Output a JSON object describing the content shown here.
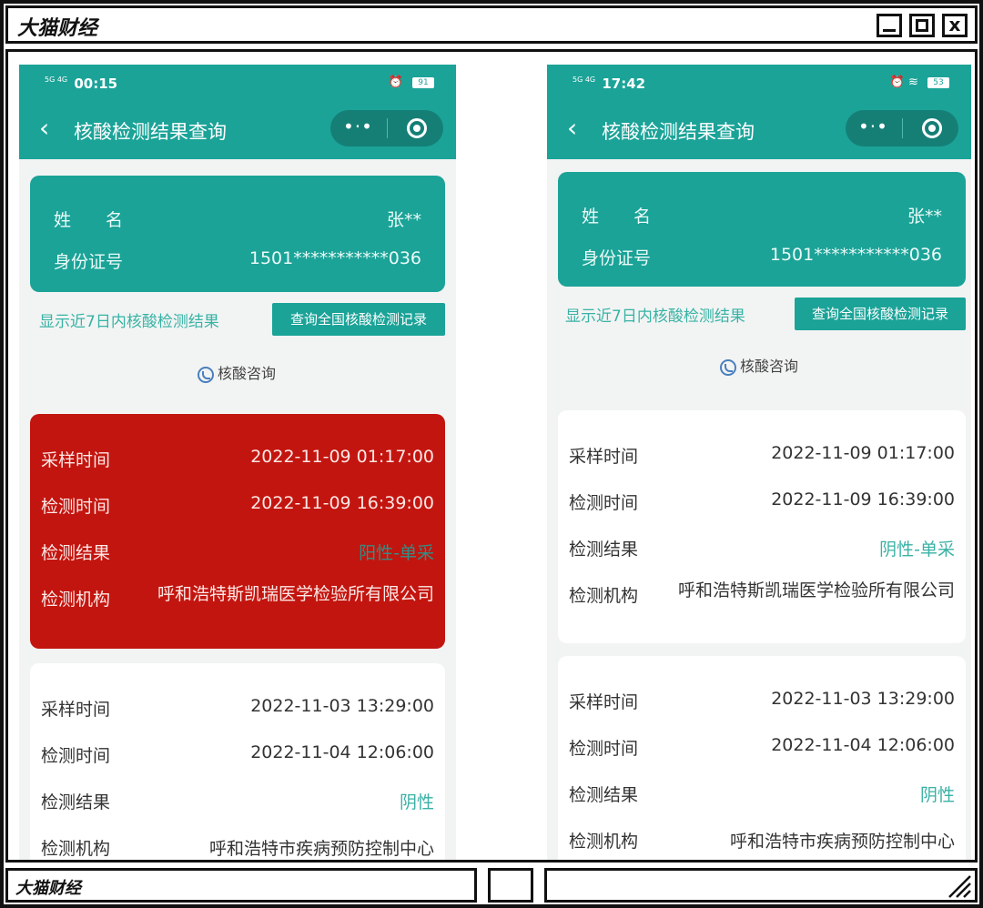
{
  "window": {
    "brand": "大猫财经",
    "footer_brand": "大猫财经",
    "close_glyph": "x"
  },
  "left": {
    "status": {
      "network": "5G 4G",
      "time": "00:15",
      "battery": "91"
    },
    "nav": {
      "back_icon": "chevron-left-icon",
      "title": "核酸检测结果查询",
      "more": "•·•"
    },
    "id": {
      "name_label": "姓　　名",
      "name_value": "张**",
      "id_label": "身份证号",
      "id_value": "1501***********036"
    },
    "hint": "显示近7日内核酸检测结果",
    "nationwide_button": "查询全国核酸检测记录",
    "consult": "核酸咨询",
    "records": [
      {
        "sample_label": "采样时间",
        "sample_value": "2022-11-09 01:17:00",
        "test_label": "检测时间",
        "test_value": "2022-11-09 16:39:00",
        "result_label": "检测结果",
        "result_value": "阳性-单采",
        "org_label": "检测机构",
        "org_value": "呼和浩特斯凯瑞医学检验所有限公司"
      },
      {
        "sample_label": "采样时间",
        "sample_value": "2022-11-03 13:29:00",
        "test_label": "检测时间",
        "test_value": "2022-11-04 12:06:00",
        "result_label": "检测结果",
        "result_value": "阴性",
        "org_label": "检测机构",
        "org_value": "呼和浩特市疾病预防控制中心"
      }
    ]
  },
  "right": {
    "status": {
      "network": "5G 4G",
      "time": "17:42",
      "battery": "53"
    },
    "nav": {
      "back_icon": "chevron-left-icon",
      "title": "核酸检测结果查询",
      "more": "•·•"
    },
    "id": {
      "name_label": "姓　　名",
      "name_value": "张**",
      "id_label": "身份证号",
      "id_value": "1501***********036"
    },
    "hint": "显示近7日内核酸检测结果",
    "nationwide_button": "查询全国核酸检测记录",
    "consult": "核酸咨询",
    "records": [
      {
        "sample_label": "采样时间",
        "sample_value": "2022-11-09 01:17:00",
        "test_label": "检测时间",
        "test_value": "2022-11-09 16:39:00",
        "result_label": "检测结果",
        "result_value": "阴性-单采",
        "org_label": "检测机构",
        "org_value": "呼和浩特斯凯瑞医学检验所有限公司"
      },
      {
        "sample_label": "采样时间",
        "sample_value": "2022-11-03 13:29:00",
        "test_label": "检测时间",
        "test_value": "2022-11-04 12:06:00",
        "result_label": "检测结果",
        "result_value": "阴性",
        "org_label": "检测机构",
        "org_value": "呼和浩特市疾病预防控制中心"
      }
    ]
  },
  "colors": {
    "teal": "#1ba398",
    "positive_red": "#c3150f",
    "result_teal": "#3ab1a5"
  }
}
